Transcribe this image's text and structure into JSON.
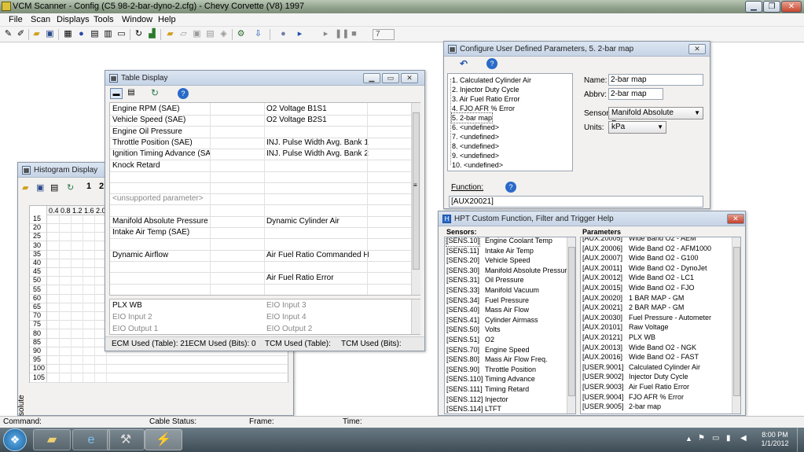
{
  "window": {
    "title": "VCM Scanner  -  Config  (C5 98-2-bar-dyno-2.cfg)  -  Chevy Corvette (V8) 1997"
  },
  "menu": [
    "File",
    "Scan",
    "Displays",
    "Tools",
    "Window",
    "Help"
  ],
  "toolbar": {
    "counter": "7"
  },
  "table_display": {
    "title": "Table Display",
    "rows": [
      [
        "Engine RPM (SAE)",
        "O2 Voltage B1S1"
      ],
      [
        "Vehicle Speed (SAE)",
        "O2 Voltage B2S1"
      ],
      [
        "Engine Oil Pressure",
        ""
      ],
      [
        "Throttle Position (SAE)",
        "INJ. Pulse Width Avg. Bank 1"
      ],
      [
        "Ignition Timing Advance (SAE)",
        "INJ. Pulse Width Avg. Bank 2"
      ],
      [
        "Knock Retard",
        ""
      ],
      [
        "",
        ""
      ],
      [
        "",
        ""
      ],
      [
        "<unsupported parameter>",
        ""
      ],
      [
        "",
        ""
      ],
      [
        "Manifold Absolute Pressure (SAE",
        "Dynamic Cylinder Air"
      ],
      [
        "Intake Air Temp (SAE)",
        ""
      ],
      [
        "",
        ""
      ],
      [
        "Dynamic Airflow",
        "Air Fuel Ratio Commanded Hi Re"
      ],
      [
        "",
        ""
      ],
      [
        "",
        "Air Fuel Ratio Error"
      ]
    ],
    "lower_rows": [
      [
        "PLX WB",
        "EIO Input 3"
      ],
      [
        "EIO Input 2",
        "EIO Input 4"
      ],
      [
        "EIO Output 1",
        "EIO Output 2"
      ]
    ],
    "status": [
      "ECM Used (Table): 21",
      "ECM Used (Bits): 0",
      "TCM Used (Table):",
      "TCM Used (Bits):"
    ]
  },
  "histogram": {
    "title": "Histogram Display",
    "tb_nums": [
      "1",
      "2"
    ],
    "x_ticks": [
      "0.4",
      "0.8",
      "1.2",
      "1.6",
      "2.0"
    ],
    "y_ticks": [
      "15",
      "20",
      "25",
      "30",
      "35",
      "40",
      "45",
      "50",
      "55",
      "60",
      "65",
      "70",
      "75",
      "80",
      "85",
      "90",
      "95",
      "100",
      "105"
    ],
    "y_axis_label": "solute Pressure (kPa)"
  },
  "configure": {
    "title": "Configure User Defined Parameters,  5. 2-bar map",
    "tree": [
      "1. Calculated Cylinder Air",
      "2. Injector Duty Cycle",
      "3. Air Fuel Ratio Error",
      "4. FJO AFR % Error",
      "5. 2-bar map",
      "6. <undefined>",
      "7. <undefined>",
      "8. <undefined>",
      "9. <undefined>",
      "10. <undefined>"
    ],
    "name_label": "Name:",
    "name_value": "2-bar map",
    "abbrv_label": "Abbrv:",
    "abbrv_value": "2-bar map",
    "sensor_label": "Sensor:",
    "sensor_value": "Manifold Absolute Pressure",
    "units_label": "Units:",
    "units_value": "kPa",
    "function_label": "Function:",
    "function_value": "[AUX20021]"
  },
  "help": {
    "title": "HPT Custom Function, Filter and Trigger Help",
    "sensors_header": "Sensors:",
    "params_header": "Parameters",
    "sensors": [
      [
        "[SENS.10]",
        "Engine Coolant Temp"
      ],
      [
        "[SENS.11]",
        "Intake Air Temp"
      ],
      [
        "[SENS.20]",
        "Vehicle Speed"
      ],
      [
        "[SENS.30]",
        "Manifold Absolute Pressure"
      ],
      [
        "[SENS.31]",
        "Oil Pressure"
      ],
      [
        "[SENS.33]",
        "Manifold Vacuum"
      ],
      [
        "[SENS.34]",
        "Fuel Pressure"
      ],
      [
        "[SENS.40]",
        "Mass Air Flow"
      ],
      [
        "[SENS.41]",
        "Cylinder Airmass"
      ],
      [
        "[SENS.50]",
        "Volts"
      ],
      [
        "[SENS.51]",
        "O2"
      ],
      [
        "[SENS.70]",
        "Engine Speed"
      ],
      [
        "[SENS.80]",
        "Mass Air Flow Freq."
      ],
      [
        "[SENS.90]",
        "Throttle Position"
      ],
      [
        "[SENS.110]",
        "Timing Advance"
      ],
      [
        "[SENS.111]",
        "Timing Retard"
      ],
      [
        "[SENS.112]",
        "Injector"
      ],
      [
        "[SENS.114]",
        "LTFT"
      ]
    ],
    "params": [
      [
        "[AUX.20005]",
        "Wide Band O2 - AEM"
      ],
      [
        "[AUX.20006]",
        "Wide Band O2 - AFM1000"
      ],
      [
        "[AUX.20007]",
        "Wide Band O2 - G100"
      ],
      [
        "[AUX.20011]",
        "Wide Band O2 - DynoJet"
      ],
      [
        "[AUX.20012]",
        "Wide Band O2 - LC1"
      ],
      [
        "[AUX.20015]",
        "Wide Band O2 - FJO"
      ],
      [
        "[AUX.20020]",
        "1 BAR MAP - GM"
      ],
      [
        "[AUX.20021]",
        "2 BAR MAP - GM"
      ],
      [
        "[AUX.20030]",
        "Fuel Pressure - Autometer"
      ],
      [
        "[AUX.20101]",
        "Raw Voltage"
      ],
      [
        "[AUX.20121]",
        "PLX WB"
      ],
      [
        "[AUX.20013]",
        "Wide Band O2 - NGK"
      ],
      [
        "[AUX.20016]",
        "Wide Band O2 - FAST"
      ],
      [
        "[USER.9001]",
        "Calculated Cylinder Air"
      ],
      [
        "[USER.9002]",
        "Injector Duty Cycle"
      ],
      [
        "[USER.9003]",
        "Air Fuel Ratio Error"
      ],
      [
        "[USER.9004]",
        "FJO AFR % Error"
      ],
      [
        "[USER.9005]",
        "2-bar map"
      ]
    ]
  },
  "status": {
    "command": "Command:",
    "cable": "Cable Status:",
    "frame": "Frame:",
    "time": "Time:"
  },
  "clock": {
    "time": "8:00 PM",
    "date": "1/1/2012"
  }
}
